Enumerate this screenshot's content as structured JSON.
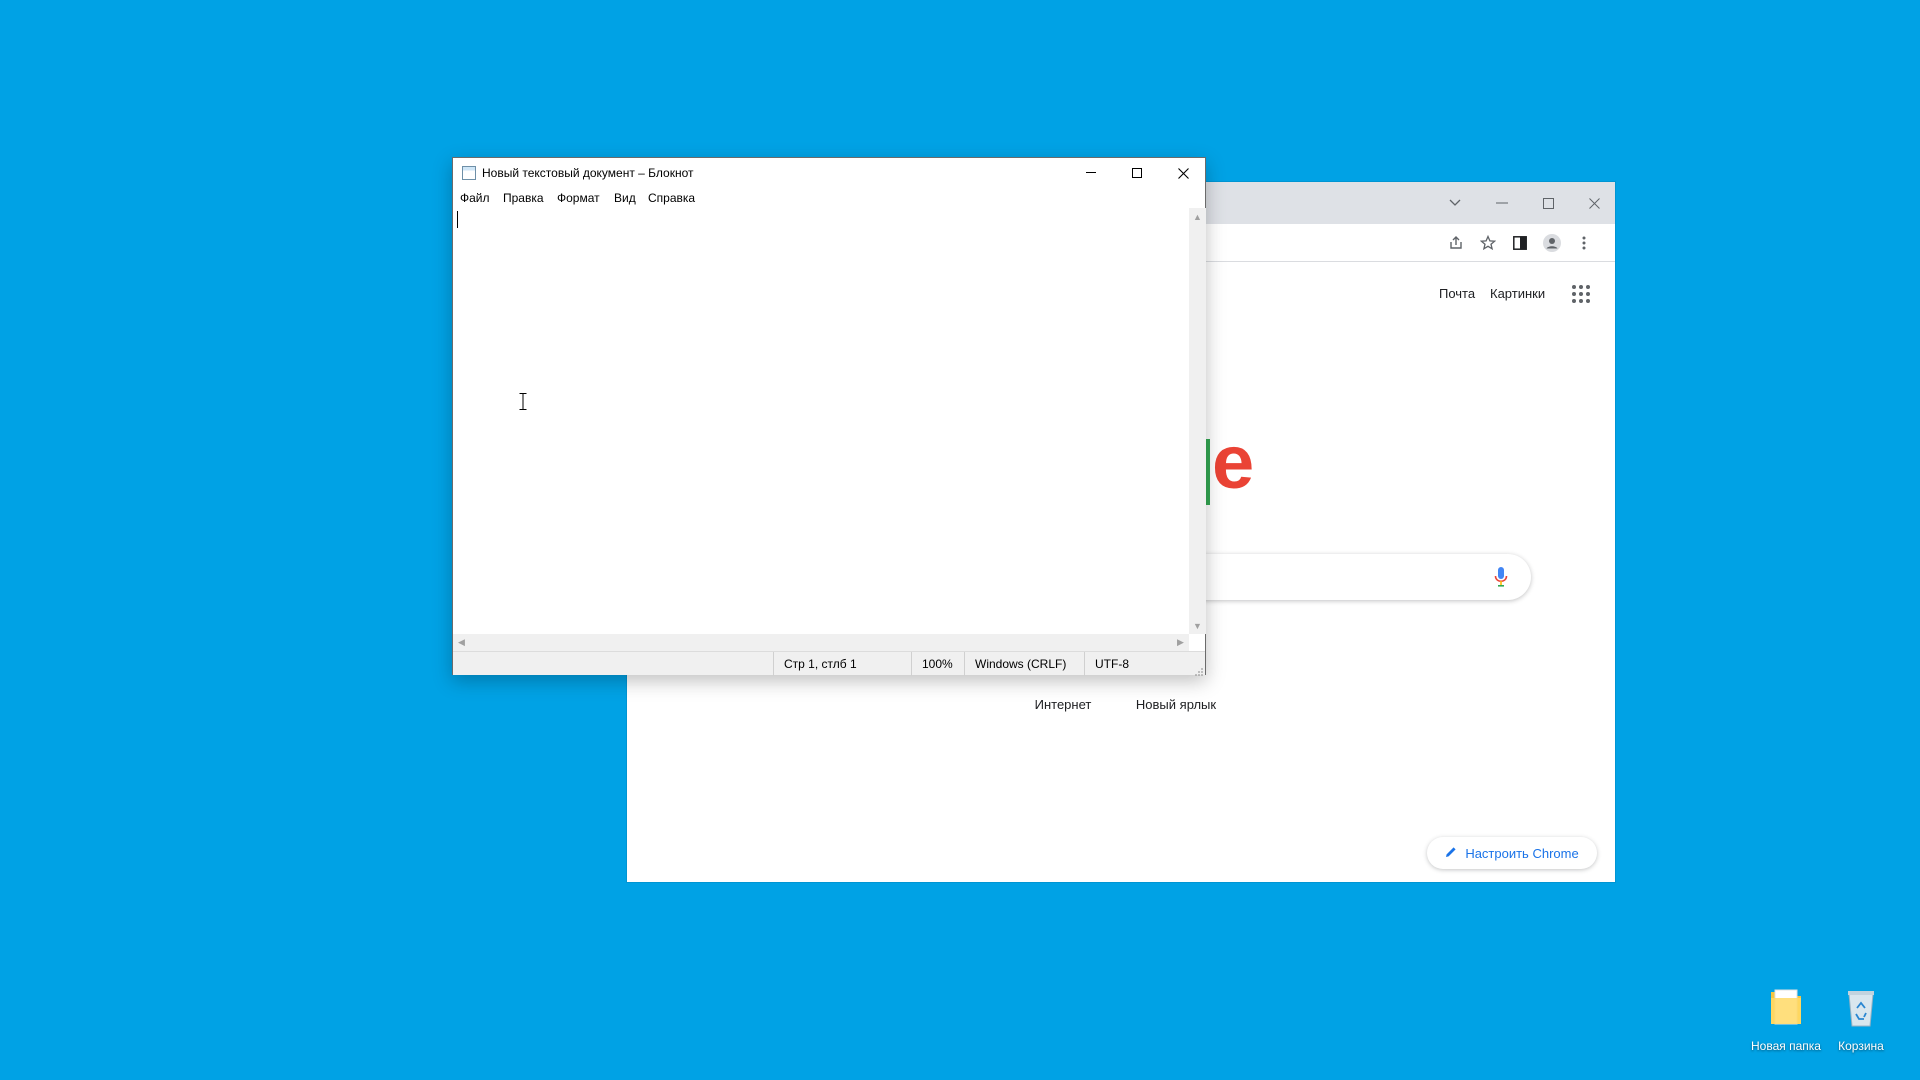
{
  "notepad": {
    "title": "Новый текстовый документ – Блокнот",
    "menu": [
      "Файл",
      "Правка",
      "Формат",
      "Вид",
      "Справка"
    ],
    "content": "",
    "status": {
      "position": "Стр 1, стлб 1",
      "zoom": "100%",
      "line_endings": "Windows (CRLF)",
      "encoding": "UTF-8"
    }
  },
  "chrome": {
    "top_links": {
      "mail": "Почта",
      "images": "Картинки"
    },
    "shortcuts": [
      "Интернет",
      "Новый ярлык"
    ],
    "customize_label": "Настроить Chrome",
    "logo_visible_letters": "le"
  },
  "desktop": {
    "icons": [
      {
        "label": "Новая папка",
        "icon": "folder-icon"
      },
      {
        "label": "Корзина",
        "icon": "recycle-bin-icon"
      }
    ]
  },
  "colors": {
    "desktop_background": "#00a2e5",
    "chrome_accent": "#1a73e8",
    "google_red": "#ea4335",
    "google_green": "#34a853"
  }
}
